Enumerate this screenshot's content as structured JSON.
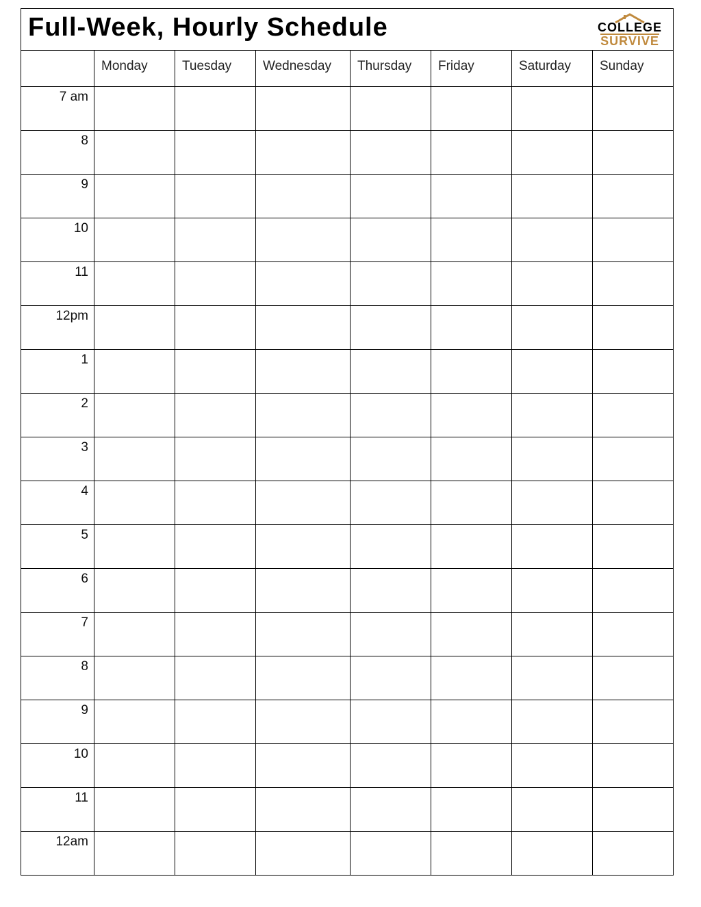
{
  "title": "Full-Week, Hourly Schedule",
  "logo": {
    "line1": "COLLEGE",
    "line2": "SURVIVE"
  },
  "days": [
    "Monday",
    "Tuesday",
    "Wednesday",
    "Thursday",
    "Friday",
    "Saturday",
    "Sunday"
  ],
  "hours": [
    "7 am",
    "8",
    "9",
    "10",
    "11",
    "12pm",
    "1",
    "2",
    "3",
    "4",
    "5",
    "6",
    "7",
    "8",
    "9",
    "10",
    "11",
    "12am"
  ]
}
